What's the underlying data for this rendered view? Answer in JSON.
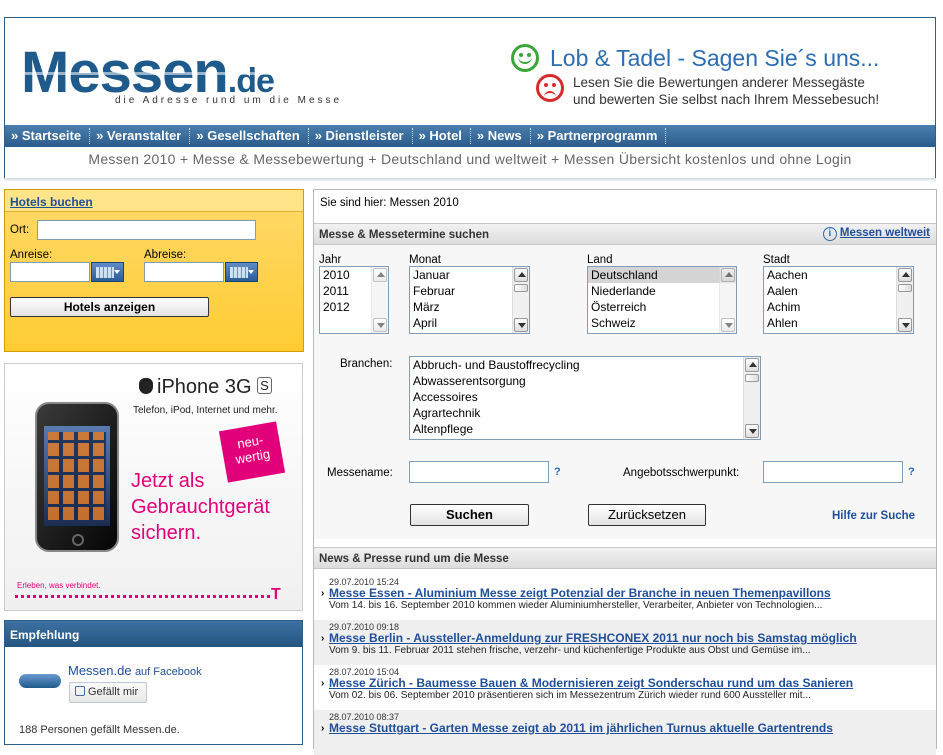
{
  "header": {
    "logo_text": "Messen",
    "logo_suffix": ".de",
    "logo_tagline": "die Adresse rund um die Messe",
    "feedback_title": "Lob & Tadel - Sagen Sie´s uns...",
    "feedback_line1": "Lesen Sie die Bewertungen anderer Messegäste",
    "feedback_line2": "und bewerten Sie selbst nach Ihrem Messebesuch!",
    "nav": [
      "» Startseite",
      "» Veranstalter",
      "» Gesellschaften",
      "» Dienstleister",
      "» Hotel",
      "» News",
      "» Partnerprogramm"
    ],
    "tagline": "Messen 2010 + Messe & Messebewertung + Deutschland und weltweit + Messen Übersicht kostenlos und ohne Login"
  },
  "hotels": {
    "title": "Hotels buchen",
    "ort_label": "Ort:",
    "anreise_label": "Anreise:",
    "abreise_label": "Abreise:",
    "button_label": "Hotels anzeigen"
  },
  "ad": {
    "product": "iPhone 3G",
    "product_badge": "S",
    "subtitle": "Telefon, iPod, Internet und mehr.",
    "badge_line1": "neu-",
    "badge_line2": "wertig",
    "headline_line1": "Jetzt als",
    "headline_line2": "Gebrauchtgerät",
    "headline_line3": "sichern.",
    "slogan": "Erleben, was verbindet.",
    "brand_mark": "T"
  },
  "recommendation": {
    "title": "Empfehlung",
    "page_name": "Messen.de",
    "page_suffix": "auf Facebook",
    "like_label": "Gefällt mir",
    "likes_text": "188 Personen gefällt Messen.de."
  },
  "main": {
    "breadcrumb": "Sie sind hier: Messen 2010",
    "search_title": "Messe & Messetermine suchen",
    "worldwide_link": "Messen weltweit",
    "info_icon_text": "i",
    "jahr_label": "Jahr",
    "jahr_options": [
      "2010",
      "2011",
      "2012"
    ],
    "monat_label": "Monat",
    "monat_options": [
      "Januar",
      "Februar",
      "März",
      "April"
    ],
    "land_label": "Land",
    "land_options": [
      "Deutschland",
      "Niederlande",
      "Österreich",
      "Schweiz"
    ],
    "land_selected": "Deutschland",
    "stadt_label": "Stadt",
    "stadt_options": [
      "Aachen",
      "Aalen",
      "Achim",
      "Ahlen"
    ],
    "branchen_label": "Branchen:",
    "branchen_options": [
      "Abbruch- und Baustoffrecycling",
      "Abwasserentsorgung",
      "Accessoires",
      "Agrartechnik",
      "Altenpflege"
    ],
    "messename_label": "Messename:",
    "angebot_label": "Angebotsschwerpunkt:",
    "help_mark": "?",
    "search_button": "Suchen",
    "reset_button": "Zurücksetzen",
    "help_link": "Hilfe zur Suche",
    "news_title": "News & Presse rund um die Messe",
    "news_arrow": "›",
    "news": [
      {
        "date": "29.07.2010 15:24",
        "title": "Messe Essen - Aluminium Messe zeigt Potenzial der Branche in neuen Themenpavillons",
        "desc": "Vom 14. bis 16. September 2010 kommen wieder Aluminiumhersteller, Verarbeiter, Anbieter von Technologien..."
      },
      {
        "date": "29.07.2010 09:18",
        "title": "Messe Berlin - Aussteller-Anmeldung zur FRESHCONEX 2011 nur noch bis Samstag möglich",
        "desc": "Vom 9. bis 11. Februar 2011 stehen frische, verzehr- und küchenfertige Produkte aus Obst und Gemüse im..."
      },
      {
        "date": "28.07.2010 15:04",
        "title": "Messe Zürich - Baumesse Bauen & Modernisieren zeigt Sonderschau rund um das Sanieren",
        "desc": "Vom 02. bis 06. September 2010 präsentieren sich im Messezentrum Zürich wieder rund 600 Aussteller mit..."
      },
      {
        "date": "28.07.2010 08:37",
        "title": "Messe Stuttgart - Garten Messe zeigt ab 2011 im jährlichen Turnus aktuelle Gartentrends",
        "desc": ""
      }
    ]
  }
}
